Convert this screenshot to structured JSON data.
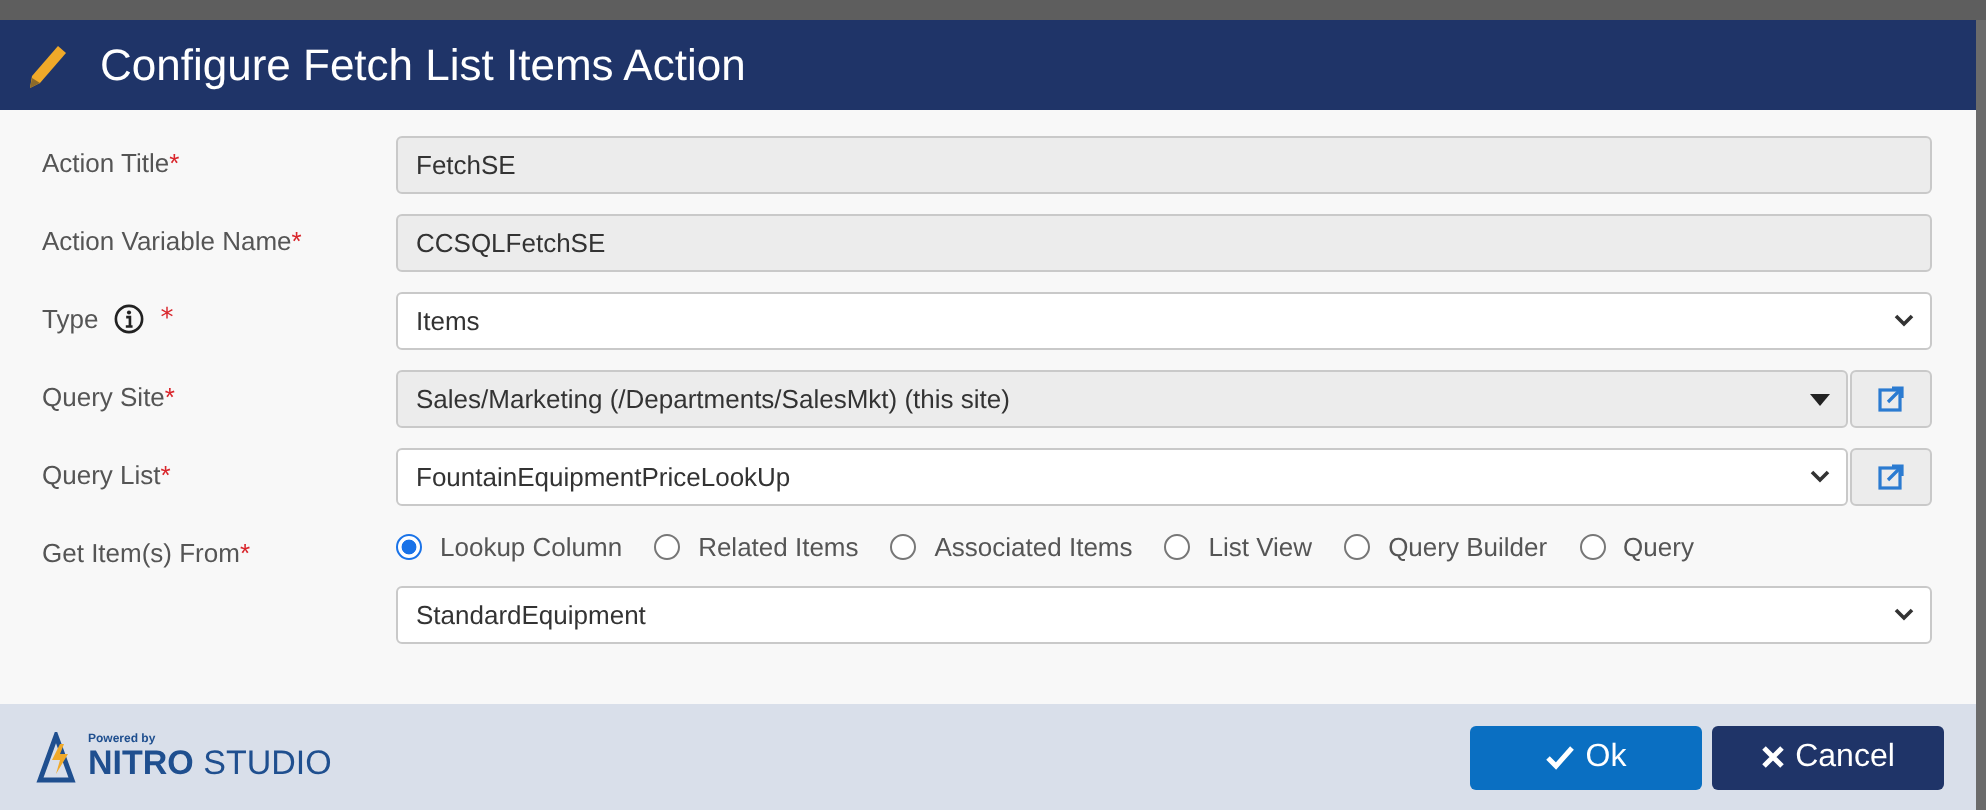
{
  "dialog": {
    "title": "Configure Fetch List Items Action"
  },
  "fields": [
    {
      "kind": "text",
      "label": "Action Title",
      "required_mark": "*",
      "value": "FetchSE",
      "disabled": true
    },
    {
      "kind": "text",
      "label": "Action Variable Name",
      "required_mark": "*",
      "value": "CCSQLFetchSE",
      "disabled": true
    },
    {
      "kind": "select",
      "label": "Type",
      "required_mark": "*",
      "info": true,
      "value": "Items",
      "disabled": false
    },
    {
      "kind": "site",
      "label": "Query Site",
      "required_mark": "*",
      "value": "Sales/Marketing (/Departments/SalesMkt) (this site)",
      "disabled": true,
      "link": true
    },
    {
      "kind": "select",
      "label": "Query List",
      "required_mark": "*",
      "value": "FountainEquipmentPriceLookUp",
      "disabled": false,
      "link": true
    },
    {
      "kind": "radios",
      "label": "Get Item(s) From",
      "required_mark": "*",
      "options": [
        {
          "label": "Lookup Column",
          "selected": true
        },
        {
          "label": "Related Items",
          "selected": false
        },
        {
          "label": "Associated Items",
          "selected": false
        },
        {
          "label": "List View",
          "selected": false
        },
        {
          "label": "Query Builder",
          "selected": false
        },
        {
          "label": "Query",
          "selected": false
        }
      ]
    },
    {
      "kind": "select",
      "value": "StandardEquipment",
      "disabled": false
    }
  ],
  "footer": {
    "powered_by": "Powered by",
    "brand": "NITRO",
    "brand_suffix": "STUDIO",
    "buttons": [
      {
        "label": "Ok",
        "kind": "primary"
      },
      {
        "label": "Cancel",
        "kind": "secondary"
      }
    ]
  }
}
